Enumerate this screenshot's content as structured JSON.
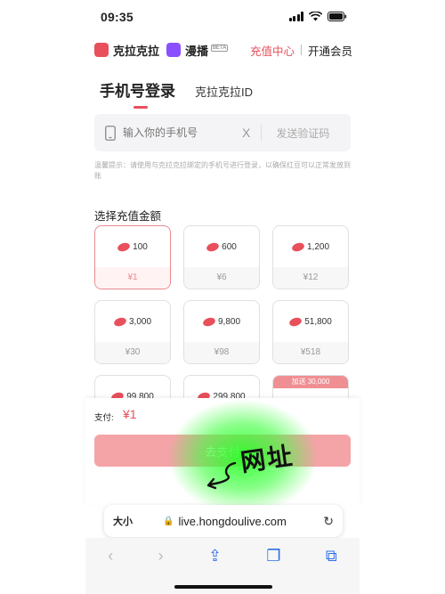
{
  "status": {
    "time": "09:35"
  },
  "brand": {
    "kela_name": "克拉克拉",
    "manbo_name": "漫播",
    "beta": "BETA",
    "recharge_center": "充值中心",
    "vip": "开通会员"
  },
  "tabs": {
    "phone_login": "手机号登录",
    "kela_id": "克拉克拉ID"
  },
  "phone": {
    "placeholder": "输入你的手机号",
    "clear": "X",
    "send_code": "发送验证码"
  },
  "hint": "温馨提示：请使用与克拉克拉绑定的手机号进行登录，以确保红豆可以正常发放到账",
  "select_label": "选择充值金额",
  "packages": [
    {
      "beans": "100",
      "price": "¥1"
    },
    {
      "beans": "600",
      "price": "¥6"
    },
    {
      "beans": "1,200",
      "price": "¥12"
    },
    {
      "beans": "3,000",
      "price": "¥30"
    },
    {
      "beans": "9,800",
      "price": "¥98"
    },
    {
      "beans": "51,800",
      "price": "¥518"
    },
    {
      "beans": "99,800",
      "price": ""
    },
    {
      "beans": "299,800",
      "price": ""
    },
    {
      "beans": "",
      "price": "",
      "bonus": "加送 30,000"
    }
  ],
  "pay": {
    "label": "支付:",
    "amount": "¥1",
    "button": "去支付"
  },
  "annotation": "网址",
  "browser": {
    "aa": "大小",
    "url": "live.hongdoulive.com"
  },
  "colors": {
    "accent": "#e8505b",
    "glow": "#2bff2b"
  }
}
